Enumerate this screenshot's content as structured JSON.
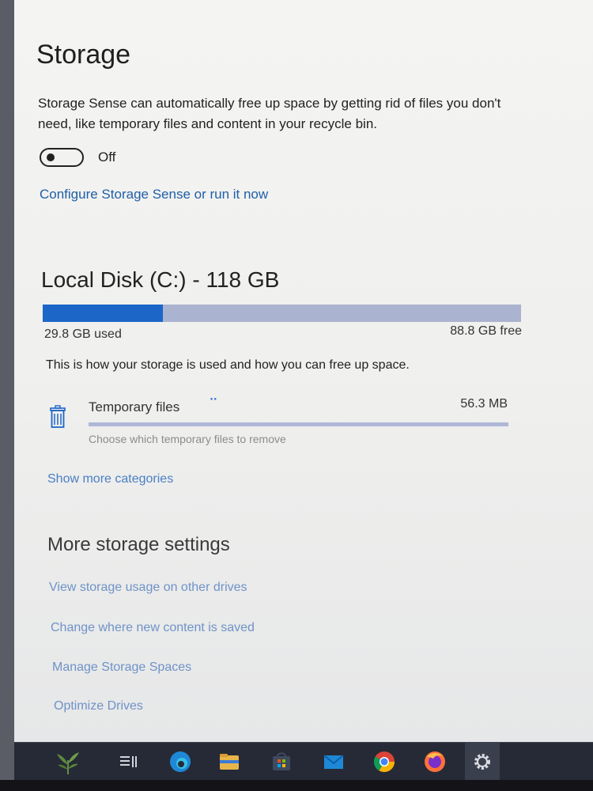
{
  "storage": {
    "title": "Storage",
    "description": "Storage Sense can automatically free up space by getting rid of files you don't need, like temporary files and content in your recycle bin.",
    "toggle_state": "Off",
    "toggle_on": false,
    "configure_link": "Configure Storage Sense or run it now"
  },
  "disk": {
    "title": "Local Disk (C:) - 118 GB",
    "used": "29.8 GB used",
    "free": "88.8 GB free",
    "used_fraction": 0.252,
    "usage_description": "This is how your storage is used and how you can free up space."
  },
  "categories": [
    {
      "label": "Temporary files",
      "size": "56.3 MB",
      "hint": "Choose which temporary files to remove",
      "icon": "trash-icon",
      "fill_fraction": 0.0
    }
  ],
  "show_more_link": "Show more categories",
  "more_settings": {
    "title": "More storage settings",
    "links": [
      "View storage usage on other drives",
      "Change where new content is saved",
      "Manage Storage Spaces",
      "Optimize Drives"
    ]
  },
  "taskbar": {
    "icons": [
      "plant-icon",
      "task-view-icon",
      "edge-icon",
      "file-explorer-icon",
      "store-icon",
      "mail-icon",
      "chrome-icon",
      "firefox-icon",
      "settings-icon"
    ]
  },
  "colors": {
    "accent": "#1c66c7",
    "bar_track": "#aab3cf",
    "link": "#1f5fa8",
    "taskbar": "#262a36"
  }
}
